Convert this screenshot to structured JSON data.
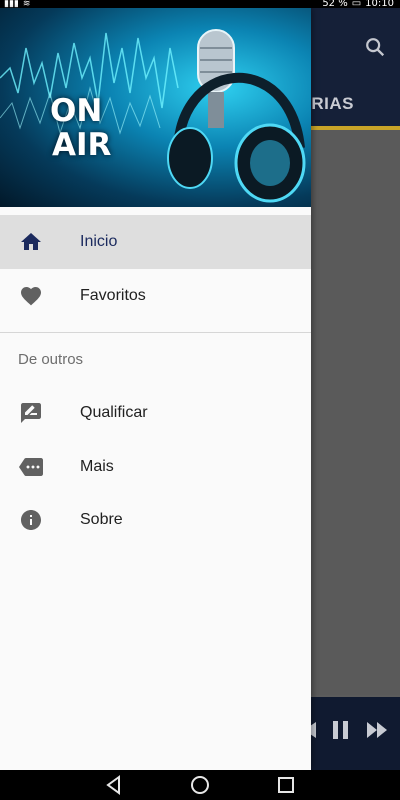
{
  "status_bar": {
    "battery_percent": "52 %",
    "time": "10:10"
  },
  "background_app": {
    "tab_label": "ORIAS",
    "accent_color": "#c8a428",
    "toolbar_color": "#152038"
  },
  "drawer": {
    "header_text_line1": "ON",
    "header_text_line2": "AIR",
    "items": [
      {
        "label": "Inicio",
        "icon": "home-icon",
        "active": true
      },
      {
        "label": "Favoritos",
        "icon": "heart-icon",
        "active": false
      }
    ],
    "section_title": "De outros",
    "other_items": [
      {
        "label": "Qualificar",
        "icon": "rate-review-icon"
      },
      {
        "label": "Mais",
        "icon": "more-tag-icon"
      },
      {
        "label": "Sobre",
        "icon": "info-icon"
      }
    ]
  }
}
